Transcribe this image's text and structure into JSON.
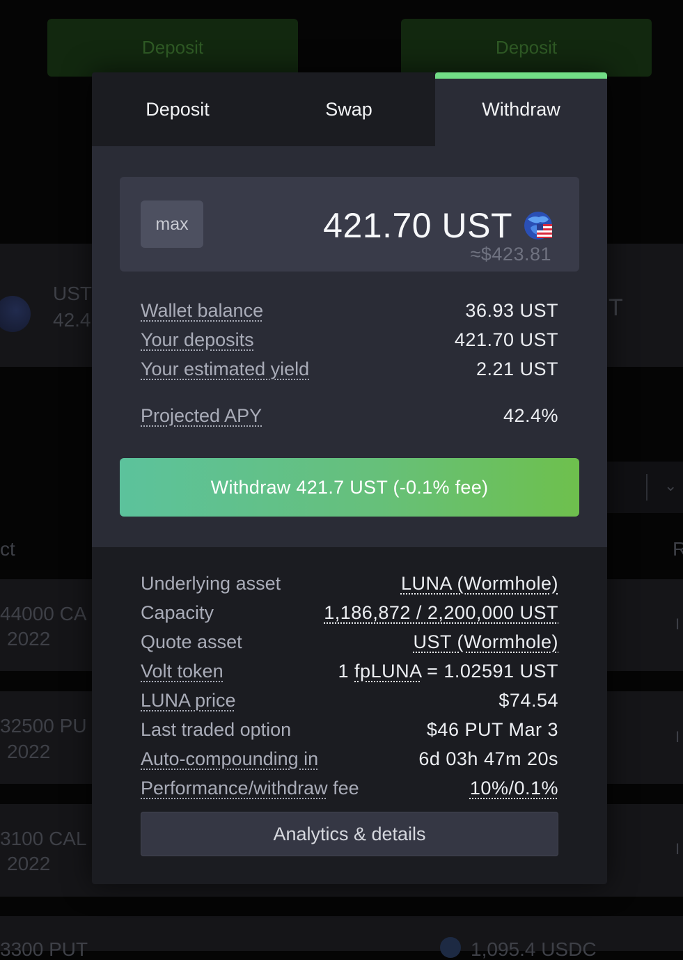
{
  "background": {
    "deposit_left": "Deposit",
    "deposit_right": "Deposit",
    "card1_symbol": "UST",
    "card1_apy": "42.4",
    "card1_right": "T",
    "col_left": "ct",
    "col_right": "R",
    "row1_a": "44000 CA",
    "row1_b": "2022",
    "row2_a": "32500 PU",
    "row2_b": "2022",
    "row3_a": "3100 CAL",
    "row3_b": "2022",
    "row4_a": "3300 PUT",
    "row4_usdc": "1,095.4 USDC",
    "row_marker": "I"
  },
  "modal": {
    "tabs": [
      {
        "label": "Deposit",
        "active": false
      },
      {
        "label": "Swap",
        "active": false
      },
      {
        "label": "Withdraw",
        "active": true
      }
    ],
    "amount": {
      "max_label": "max",
      "value": "421.70 UST",
      "usd_estimate": "≈$423.81",
      "icon": "ust-coin-icon"
    },
    "stats": {
      "wallet_balance_label": "Wallet balance",
      "wallet_balance_value": "36.93 UST",
      "your_deposits_label": "Your deposits",
      "your_deposits_value": "421.70 UST",
      "estimated_yield_label": "Your estimated yield",
      "estimated_yield_value": "2.21 UST",
      "projected_apy_label": "Projected APY",
      "projected_apy_value": "42.4%"
    },
    "withdraw_button": "Withdraw 421.7 UST (-0.1% fee)",
    "details": {
      "underlying_asset_label": "Underlying asset",
      "underlying_asset_value": "LUNA (Wormhole)",
      "capacity_label": "Capacity",
      "capacity_value": "1,186,872 / 2,200,000 UST",
      "quote_asset_label": "Quote asset",
      "quote_asset_value": "UST (Wormhole)",
      "volt_token_label": "Volt token",
      "volt_token_prefix": "1",
      "volt_token_symbol": "fpLUNA",
      "volt_token_suffix": "= 1.02591 UST",
      "luna_price_label": "LUNA price",
      "luna_price_value": "$74.54",
      "last_traded_label": "Last traded option",
      "last_traded_value": "$46 PUT Mar 3",
      "autocompound_label": "Auto-compounding in",
      "autocompound_value": "6d 03h 47m 20s",
      "fee_label_link": "Performance/withdraw",
      "fee_label_rest": "fee",
      "fee_value": "10%/0.1%"
    },
    "analytics_button": "Analytics & details"
  },
  "colors": {
    "accent_green": "#72dd86",
    "button_gradient_start": "#5cc29c",
    "button_gradient_end": "#6ec04d",
    "modal_bg": "#1b1c21",
    "panel_bg": "#2a2c36"
  }
}
